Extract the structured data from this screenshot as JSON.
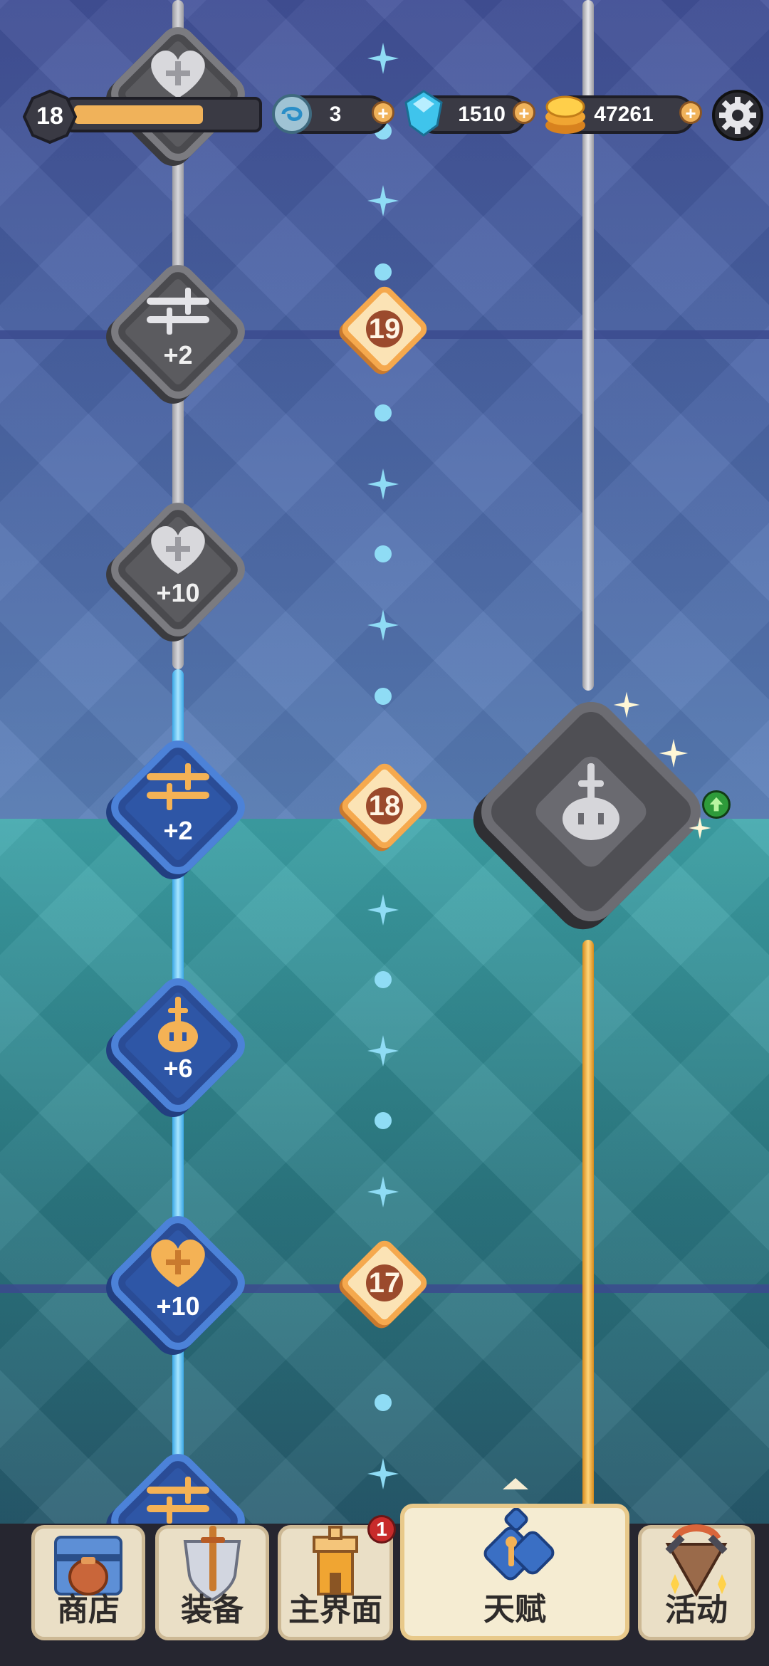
{
  "hud": {
    "player_level": "18",
    "xp_progress": 0.72,
    "rune_count": "3",
    "gem_count": "1510",
    "coin_count": "47261",
    "plus_label": "+"
  },
  "colors": {
    "accent_gold": "#f0b25a",
    "locked_gray": "#5b5b5f",
    "unlocked_blue": "#2e56a6"
  },
  "talents": [
    {
      "icon": "heart-icon",
      "value": "",
      "state": "locked"
    },
    {
      "icon": "crossed-swords-icon",
      "value": "+2",
      "state": "locked"
    },
    {
      "icon": "heart-icon",
      "value": "+10",
      "state": "locked"
    },
    {
      "icon": "crossed-swords-icon",
      "value": "+2",
      "state": "unlocked"
    },
    {
      "icon": "helmet-sword-icon",
      "value": "+6",
      "state": "unlocked"
    },
    {
      "icon": "heart-icon",
      "value": "+10",
      "state": "unlocked"
    },
    {
      "icon": "crossed-swords-icon",
      "value": "",
      "state": "unlocked"
    }
  ],
  "milestones": [
    "19",
    "18",
    "17"
  ],
  "special_talent": {
    "icon": "helmet-sword-icon",
    "upgrade": "arrow-up-icon"
  },
  "nav": {
    "tabs": [
      {
        "label": "商店",
        "icon": "shop-chest-icon"
      },
      {
        "label": "装备",
        "icon": "shield-sword-icon"
      },
      {
        "label": "主界面",
        "icon": "castle-icon",
        "badge": "1"
      },
      {
        "label": "天赋",
        "icon": "talent-key-icon",
        "active": true
      },
      {
        "label": "活动",
        "icon": "event-fan-icon"
      }
    ]
  }
}
